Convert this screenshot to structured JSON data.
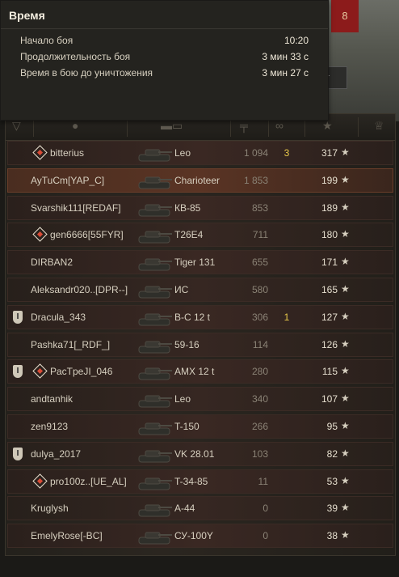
{
  "scene": {
    "flag_number": "8",
    "button_partial": "т"
  },
  "tooltip": {
    "title": "Время",
    "rows": [
      {
        "label": "Начало боя",
        "value": "10:20"
      },
      {
        "label": "Продолжительность боя",
        "value": "3 мин 33 с"
      },
      {
        "label": "Время в бою до уничтожения",
        "value": "3 мин 27 с"
      }
    ]
  },
  "table": {
    "header_icons": [
      "platoon-icon",
      "player-icon",
      "tank-icon",
      "damage-icon",
      "frags-icon",
      "xp-star-icon",
      "medal-icon"
    ],
    "players": [
      {
        "name": "bitterius",
        "vehicle": "Leo",
        "damage": "1 094",
        "frags": "3",
        "xp": "317",
        "platoon": "",
        "rank": true,
        "highlight": false
      },
      {
        "name": "AyTuCm[YAP_C]",
        "vehicle": "Charioteer",
        "damage": "1 853",
        "frags": "",
        "xp": "199",
        "platoon": "",
        "rank": false,
        "highlight": true
      },
      {
        "name": "Svarshik111[REDAF]",
        "vehicle": "КВ-85",
        "damage": "853",
        "frags": "",
        "xp": "189",
        "platoon": "",
        "rank": false,
        "highlight": false
      },
      {
        "name": "gen6666[55FYR]",
        "vehicle": "T26E4",
        "damage": "711",
        "frags": "",
        "xp": "180",
        "platoon": "",
        "rank": true,
        "highlight": false
      },
      {
        "name": "DIRBAN2",
        "vehicle": "Tiger 131",
        "damage": "655",
        "frags": "",
        "xp": "171",
        "platoon": "",
        "rank": false,
        "highlight": false
      },
      {
        "name": "Aleksandr020..[DPR--]",
        "vehicle": "ИС",
        "damage": "580",
        "frags": "",
        "xp": "165",
        "platoon": "",
        "rank": false,
        "highlight": false
      },
      {
        "name": "Dracula_343",
        "vehicle": "B-C 12 t",
        "damage": "306",
        "frags": "1",
        "xp": "127",
        "platoon": "I",
        "rank": false,
        "highlight": false
      },
      {
        "name": "Pashka71[_RDF_]",
        "vehicle": "59-16",
        "damage": "114",
        "frags": "",
        "xp": "126",
        "platoon": "",
        "rank": false,
        "highlight": false
      },
      {
        "name": "PacTpeJI_046",
        "vehicle": "AMX 12 t",
        "damage": "280",
        "frags": "",
        "xp": "115",
        "platoon": "I",
        "rank": true,
        "highlight": false
      },
      {
        "name": "andtanhik",
        "vehicle": "Leo",
        "damage": "340",
        "frags": "",
        "xp": "107",
        "platoon": "",
        "rank": false,
        "highlight": false
      },
      {
        "name": "zen9123",
        "vehicle": "T-150",
        "damage": "266",
        "frags": "",
        "xp": "95",
        "platoon": "",
        "rank": false,
        "highlight": false
      },
      {
        "name": "dulya_2017",
        "vehicle": "VK 28.01",
        "damage": "103",
        "frags": "",
        "xp": "82",
        "platoon": "I",
        "rank": false,
        "highlight": false
      },
      {
        "name": "pro100z..[UE_AL]",
        "vehicle": "T-34-85",
        "damage": "11",
        "frags": "",
        "xp": "53",
        "platoon": "",
        "rank": true,
        "highlight": false
      },
      {
        "name": "Kruglysh",
        "vehicle": "A-44",
        "damage": "0",
        "frags": "",
        "xp": "39",
        "platoon": "",
        "rank": false,
        "highlight": false
      },
      {
        "name": "EmelyRose[-BC]",
        "vehicle": "СУ-100Y",
        "damage": "0",
        "frags": "",
        "xp": "38",
        "platoon": "",
        "rank": false,
        "highlight": false
      }
    ]
  }
}
